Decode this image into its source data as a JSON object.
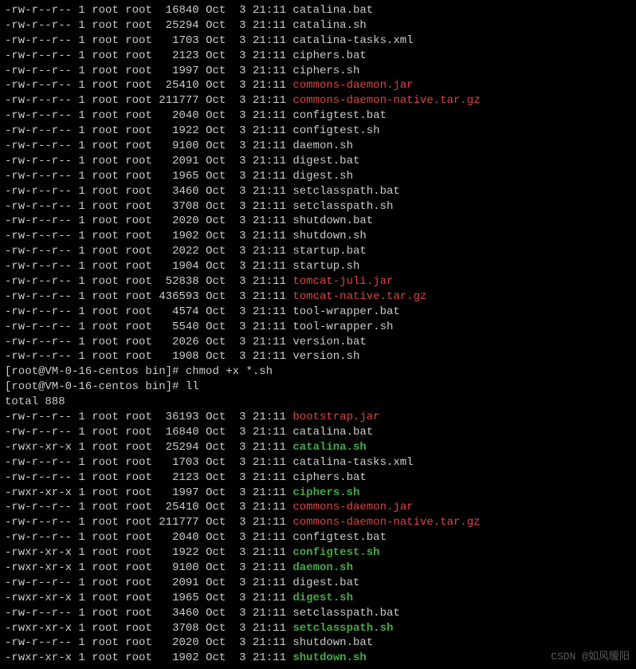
{
  "listing1": [
    {
      "perm": "-rw-r--r--",
      "links": "1",
      "owner": "root",
      "group": "root",
      "size": "16840",
      "month": "Oct",
      "day": "3",
      "time": "21:11",
      "name": "catalina.bat",
      "style": "plain"
    },
    {
      "perm": "-rw-r--r--",
      "links": "1",
      "owner": "root",
      "group": "root",
      "size": "25294",
      "month": "Oct",
      "day": "3",
      "time": "21:11",
      "name": "catalina.sh",
      "style": "plain"
    },
    {
      "perm": "-rw-r--r--",
      "links": "1",
      "owner": "root",
      "group": "root",
      "size": "1703",
      "month": "Oct",
      "day": "3",
      "time": "21:11",
      "name": "catalina-tasks.xml",
      "style": "plain"
    },
    {
      "perm": "-rw-r--r--",
      "links": "1",
      "owner": "root",
      "group": "root",
      "size": "2123",
      "month": "Oct",
      "day": "3",
      "time": "21:11",
      "name": "ciphers.bat",
      "style": "plain"
    },
    {
      "perm": "-rw-r--r--",
      "links": "1",
      "owner": "root",
      "group": "root",
      "size": "1997",
      "month": "Oct",
      "day": "3",
      "time": "21:11",
      "name": "ciphers.sh",
      "style": "plain"
    },
    {
      "perm": "-rw-r--r--",
      "links": "1",
      "owner": "root",
      "group": "root",
      "size": "25410",
      "month": "Oct",
      "day": "3",
      "time": "21:11",
      "name": "commons-daemon.jar",
      "style": "red"
    },
    {
      "perm": "-rw-r--r--",
      "links": "1",
      "owner": "root",
      "group": "root",
      "size": "211777",
      "month": "Oct",
      "day": "3",
      "time": "21:11",
      "name": "commons-daemon-native.tar.gz",
      "style": "red"
    },
    {
      "perm": "-rw-r--r--",
      "links": "1",
      "owner": "root",
      "group": "root",
      "size": "2040",
      "month": "Oct",
      "day": "3",
      "time": "21:11",
      "name": "configtest.bat",
      "style": "plain"
    },
    {
      "perm": "-rw-r--r--",
      "links": "1",
      "owner": "root",
      "group": "root",
      "size": "1922",
      "month": "Oct",
      "day": "3",
      "time": "21:11",
      "name": "configtest.sh",
      "style": "plain"
    },
    {
      "perm": "-rw-r--r--",
      "links": "1",
      "owner": "root",
      "group": "root",
      "size": "9100",
      "month": "Oct",
      "day": "3",
      "time": "21:11",
      "name": "daemon.sh",
      "style": "plain"
    },
    {
      "perm": "-rw-r--r--",
      "links": "1",
      "owner": "root",
      "group": "root",
      "size": "2091",
      "month": "Oct",
      "day": "3",
      "time": "21:11",
      "name": "digest.bat",
      "style": "plain"
    },
    {
      "perm": "-rw-r--r--",
      "links": "1",
      "owner": "root",
      "group": "root",
      "size": "1965",
      "month": "Oct",
      "day": "3",
      "time": "21:11",
      "name": "digest.sh",
      "style": "plain"
    },
    {
      "perm": "-rw-r--r--",
      "links": "1",
      "owner": "root",
      "group": "root",
      "size": "3460",
      "month": "Oct",
      "day": "3",
      "time": "21:11",
      "name": "setclasspath.bat",
      "style": "plain"
    },
    {
      "perm": "-rw-r--r--",
      "links": "1",
      "owner": "root",
      "group": "root",
      "size": "3708",
      "month": "Oct",
      "day": "3",
      "time": "21:11",
      "name": "setclasspath.sh",
      "style": "plain"
    },
    {
      "perm": "-rw-r--r--",
      "links": "1",
      "owner": "root",
      "group": "root",
      "size": "2020",
      "month": "Oct",
      "day": "3",
      "time": "21:11",
      "name": "shutdown.bat",
      "style": "plain"
    },
    {
      "perm": "-rw-r--r--",
      "links": "1",
      "owner": "root",
      "group": "root",
      "size": "1902",
      "month": "Oct",
      "day": "3",
      "time": "21:11",
      "name": "shutdown.sh",
      "style": "plain"
    },
    {
      "perm": "-rw-r--r--",
      "links": "1",
      "owner": "root",
      "group": "root",
      "size": "2022",
      "month": "Oct",
      "day": "3",
      "time": "21:11",
      "name": "startup.bat",
      "style": "plain"
    },
    {
      "perm": "-rw-r--r--",
      "links": "1",
      "owner": "root",
      "group": "root",
      "size": "1904",
      "month": "Oct",
      "day": "3",
      "time": "21:11",
      "name": "startup.sh",
      "style": "plain"
    },
    {
      "perm": "-rw-r--r--",
      "links": "1",
      "owner": "root",
      "group": "root",
      "size": "52838",
      "month": "Oct",
      "day": "3",
      "time": "21:11",
      "name": "tomcat-juli.jar",
      "style": "red"
    },
    {
      "perm": "-rw-r--r--",
      "links": "1",
      "owner": "root",
      "group": "root",
      "size": "436593",
      "month": "Oct",
      "day": "3",
      "time": "21:11",
      "name": "tomcat-native.tar.gz",
      "style": "red"
    },
    {
      "perm": "-rw-r--r--",
      "links": "1",
      "owner": "root",
      "group": "root",
      "size": "4574",
      "month": "Oct",
      "day": "3",
      "time": "21:11",
      "name": "tool-wrapper.bat",
      "style": "plain"
    },
    {
      "perm": "-rw-r--r--",
      "links": "1",
      "owner": "root",
      "group": "root",
      "size": "5540",
      "month": "Oct",
      "day": "3",
      "time": "21:11",
      "name": "tool-wrapper.sh",
      "style": "plain"
    },
    {
      "perm": "-rw-r--r--",
      "links": "1",
      "owner": "root",
      "group": "root",
      "size": "2026",
      "month": "Oct",
      "day": "3",
      "time": "21:11",
      "name": "version.bat",
      "style": "plain"
    },
    {
      "perm": "-rw-r--r--",
      "links": "1",
      "owner": "root",
      "group": "root",
      "size": "1908",
      "month": "Oct",
      "day": "3",
      "time": "21:11",
      "name": "version.sh",
      "style": "plain"
    }
  ],
  "prompt1": {
    "text": "[root@VM-0-16-centos bin]# ",
    "cmd": "chmod +x *.sh"
  },
  "prompt2": {
    "text": "[root@VM-0-16-centos bin]# ",
    "cmd": "ll"
  },
  "total_line": "total 888",
  "listing2": [
    {
      "perm": "-rw-r--r--",
      "links": "1",
      "owner": "root",
      "group": "root",
      "size": "36193",
      "month": "Oct",
      "day": "3",
      "time": "21:11",
      "name": "bootstrap.jar",
      "style": "red"
    },
    {
      "perm": "-rw-r--r--",
      "links": "1",
      "owner": "root",
      "group": "root",
      "size": "16840",
      "month": "Oct",
      "day": "3",
      "time": "21:11",
      "name": "catalina.bat",
      "style": "plain"
    },
    {
      "perm": "-rwxr-xr-x",
      "links": "1",
      "owner": "root",
      "group": "root",
      "size": "25294",
      "month": "Oct",
      "day": "3",
      "time": "21:11",
      "name": "catalina.sh",
      "style": "green"
    },
    {
      "perm": "-rw-r--r--",
      "links": "1",
      "owner": "root",
      "group": "root",
      "size": "1703",
      "month": "Oct",
      "day": "3",
      "time": "21:11",
      "name": "catalina-tasks.xml",
      "style": "plain"
    },
    {
      "perm": "-rw-r--r--",
      "links": "1",
      "owner": "root",
      "group": "root",
      "size": "2123",
      "month": "Oct",
      "day": "3",
      "time": "21:11",
      "name": "ciphers.bat",
      "style": "plain"
    },
    {
      "perm": "-rwxr-xr-x",
      "links": "1",
      "owner": "root",
      "group": "root",
      "size": "1997",
      "month": "Oct",
      "day": "3",
      "time": "21:11",
      "name": "ciphers.sh",
      "style": "green"
    },
    {
      "perm": "-rw-r--r--",
      "links": "1",
      "owner": "root",
      "group": "root",
      "size": "25410",
      "month": "Oct",
      "day": "3",
      "time": "21:11",
      "name": "commons-daemon.jar",
      "style": "red"
    },
    {
      "perm": "-rw-r--r--",
      "links": "1",
      "owner": "root",
      "group": "root",
      "size": "211777",
      "month": "Oct",
      "day": "3",
      "time": "21:11",
      "name": "commons-daemon-native.tar.gz",
      "style": "red"
    },
    {
      "perm": "-rw-r--r--",
      "links": "1",
      "owner": "root",
      "group": "root",
      "size": "2040",
      "month": "Oct",
      "day": "3",
      "time": "21:11",
      "name": "configtest.bat",
      "style": "plain"
    },
    {
      "perm": "-rwxr-xr-x",
      "links": "1",
      "owner": "root",
      "group": "root",
      "size": "1922",
      "month": "Oct",
      "day": "3",
      "time": "21:11",
      "name": "configtest.sh",
      "style": "green"
    },
    {
      "perm": "-rwxr-xr-x",
      "links": "1",
      "owner": "root",
      "group": "root",
      "size": "9100",
      "month": "Oct",
      "day": "3",
      "time": "21:11",
      "name": "daemon.sh",
      "style": "green"
    },
    {
      "perm": "-rw-r--r--",
      "links": "1",
      "owner": "root",
      "group": "root",
      "size": "2091",
      "month": "Oct",
      "day": "3",
      "time": "21:11",
      "name": "digest.bat",
      "style": "plain"
    },
    {
      "perm": "-rwxr-xr-x",
      "links": "1",
      "owner": "root",
      "group": "root",
      "size": "1965",
      "month": "Oct",
      "day": "3",
      "time": "21:11",
      "name": "digest.sh",
      "style": "green"
    },
    {
      "perm": "-rw-r--r--",
      "links": "1",
      "owner": "root",
      "group": "root",
      "size": "3460",
      "month": "Oct",
      "day": "3",
      "time": "21:11",
      "name": "setclasspath.bat",
      "style": "plain"
    },
    {
      "perm": "-rwxr-xr-x",
      "links": "1",
      "owner": "root",
      "group": "root",
      "size": "3708",
      "month": "Oct",
      "day": "3",
      "time": "21:11",
      "name": "setclasspath.sh",
      "style": "green"
    },
    {
      "perm": "-rw-r--r--",
      "links": "1",
      "owner": "root",
      "group": "root",
      "size": "2020",
      "month": "Oct",
      "day": "3",
      "time": "21:11",
      "name": "shutdown.bat",
      "style": "plain"
    },
    {
      "perm": "-rwxr-xr-x",
      "links": "1",
      "owner": "root",
      "group": "root",
      "size": "1902",
      "month": "Oct",
      "day": "3",
      "time": "21:11",
      "name": "shutdown.sh",
      "style": "green"
    }
  ],
  "watermark": "CSDN @如风暖阳"
}
